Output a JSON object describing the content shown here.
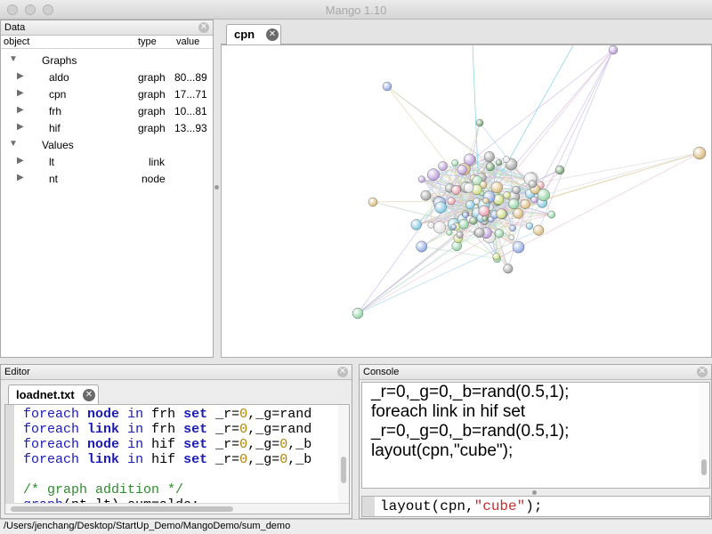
{
  "window": {
    "title": "Mango 1.10"
  },
  "data_panel": {
    "title": "Data",
    "columns": [
      "object",
      "type",
      "value"
    ],
    "graphs_label": "Graphs",
    "graphs": [
      {
        "name": "aldo",
        "type": "graph",
        "value": "80...89"
      },
      {
        "name": "cpn",
        "type": "graph",
        "value": "17...71"
      },
      {
        "name": "frh",
        "type": "graph",
        "value": "10...81"
      },
      {
        "name": "hif",
        "type": "graph",
        "value": "13...93"
      }
    ],
    "values_label": "Values",
    "values": [
      {
        "name": "lt",
        "type": "link"
      },
      {
        "name": "nt",
        "type": "node"
      }
    ]
  },
  "graph_view": {
    "tab_label": "cpn"
  },
  "editor": {
    "title": "Editor",
    "tab_label": "loadnet.txt",
    "lines": [
      {
        "kw1": "foreach",
        "kw2": "node",
        "kw3": "in",
        "g": "frh",
        "kw4": "set",
        "rest_a": "_r=",
        "n1": "0",
        "rest_b": ",_g=rand"
      },
      {
        "kw1": "foreach",
        "kw2": "link",
        "kw3": "in",
        "g": "frh",
        "kw4": "set",
        "rest_a": "_r=",
        "n1": "0",
        "rest_b": ",_g=rand"
      },
      {
        "kw1": "foreach",
        "kw2": "node",
        "kw3": "in",
        "g": "hif",
        "kw4": "set",
        "rest_a": "_r=",
        "n1": "0",
        "rest_b": ",_g=",
        "n2": "0",
        "rest_c": ",_b"
      },
      {
        "kw1": "foreach",
        "kw2": "link",
        "kw3": "in",
        "g": "hif",
        "kw4": "set",
        "rest_a": "_r=",
        "n1": "0",
        "rest_b": ",_g=",
        "n2": "0",
        "rest_c": ",_b"
      }
    ],
    "comment": "/* graph addition */",
    "partial_line_kw": "graph",
    "partial_line_rest": "(nt,lt) sum=aldo;"
  },
  "console": {
    "title": "Console",
    "output_lines": [
      "_r=0,_g=0,_b=rand(0.5,1);",
      "foreach link in hif set",
      "_r=0,_g=0,_b=rand(0.5,1);",
      "layout(cpn,\"cube\");"
    ],
    "input_prefix": "layout(cpn,",
    "input_string": "\"cube\"",
    "input_suffix": ");"
  },
  "status_bar": {
    "path": "/Users/jenchang/Desktop/StartUp_Demo/MangoDemo/sum_demo"
  }
}
